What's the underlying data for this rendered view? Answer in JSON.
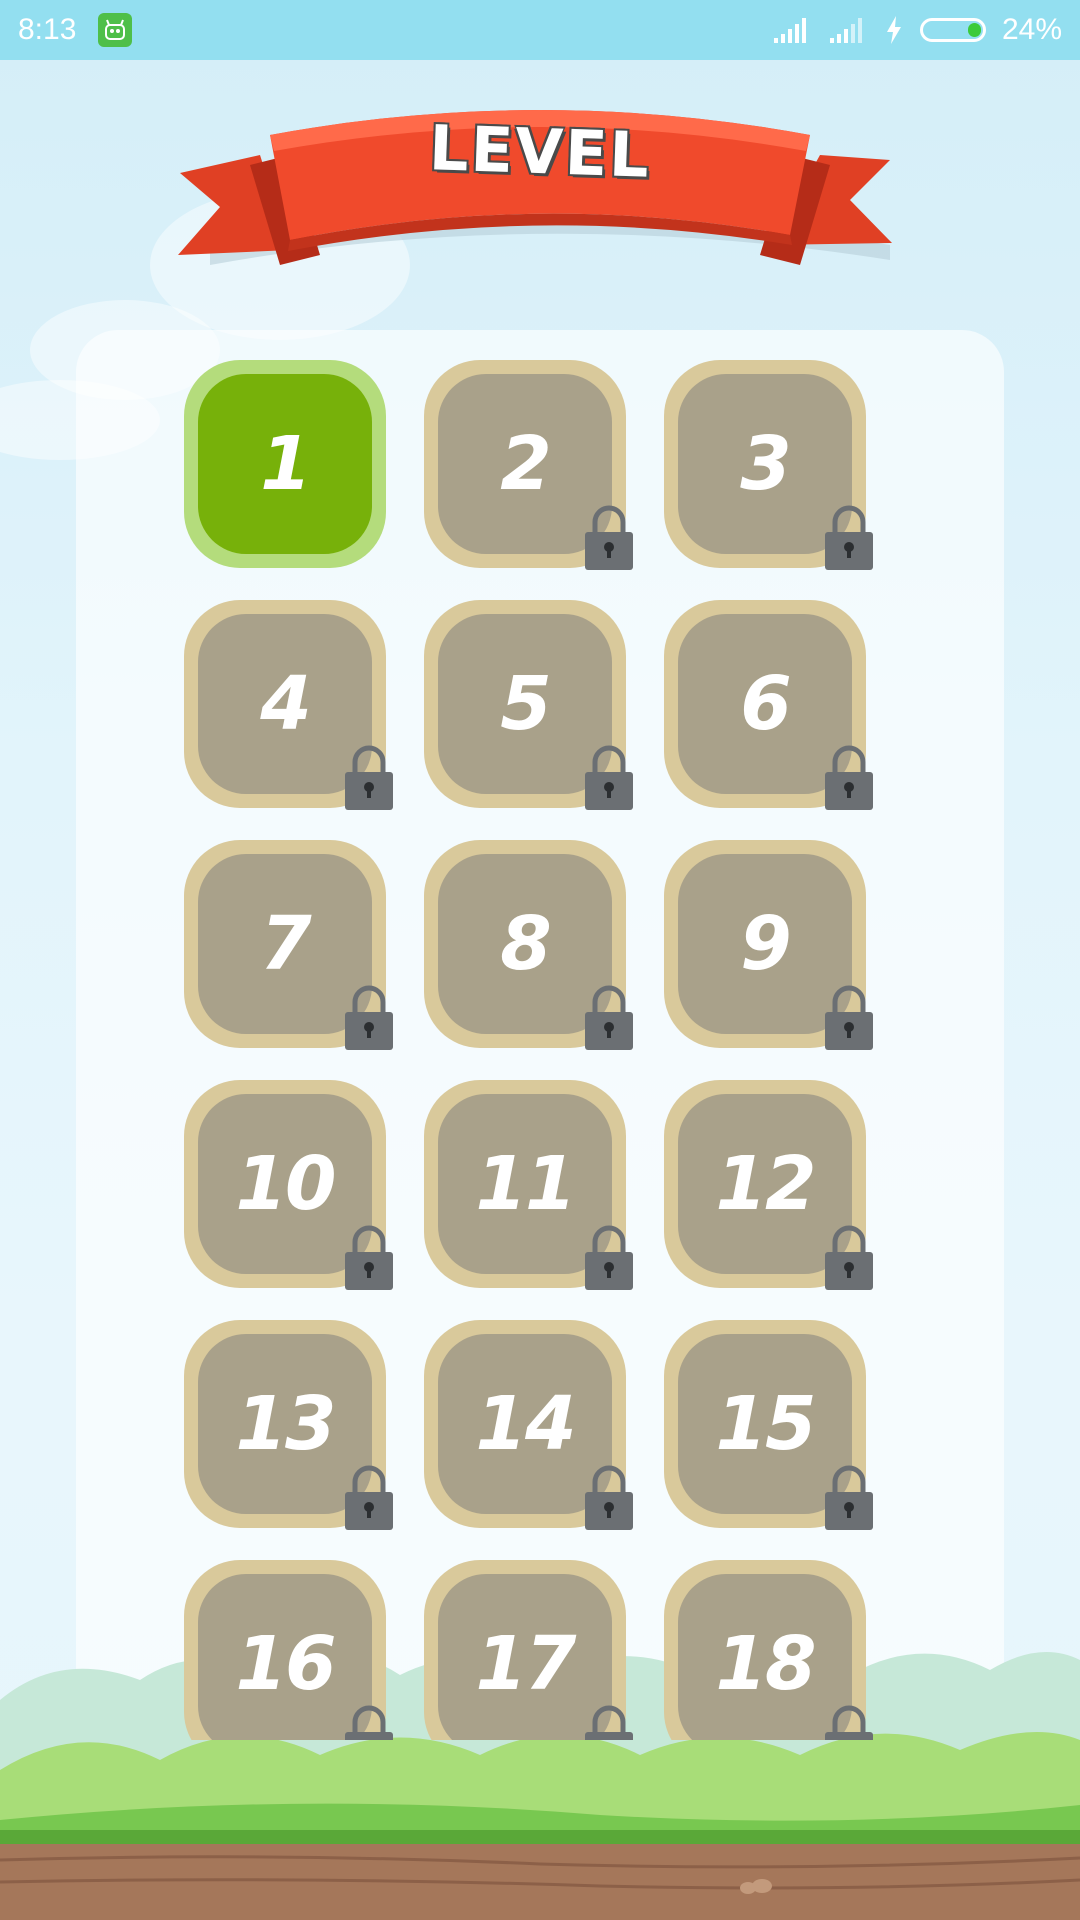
{
  "status_bar": {
    "time": "8:13",
    "battery_percent": "24%",
    "battery_level": 0.24,
    "icons": [
      "app-notification-icon",
      "cell-signal-icon",
      "cell-signal-icon",
      "charging-icon",
      "battery-icon"
    ]
  },
  "header": {
    "title": "LEVEL"
  },
  "levels": [
    {
      "number": "1",
      "locked": false
    },
    {
      "number": "2",
      "locked": true
    },
    {
      "number": "3",
      "locked": true
    },
    {
      "number": "4",
      "locked": true
    },
    {
      "number": "5",
      "locked": true
    },
    {
      "number": "6",
      "locked": true
    },
    {
      "number": "7",
      "locked": true
    },
    {
      "number": "8",
      "locked": true
    },
    {
      "number": "9",
      "locked": true
    },
    {
      "number": "10",
      "locked": true
    },
    {
      "number": "11",
      "locked": true
    },
    {
      "number": "12",
      "locked": true
    },
    {
      "number": "13",
      "locked": true
    },
    {
      "number": "14",
      "locked": true
    },
    {
      "number": "15",
      "locked": true
    },
    {
      "number": "16",
      "locked": true
    },
    {
      "number": "17",
      "locked": true
    },
    {
      "number": "18",
      "locked": true
    }
  ],
  "colors": {
    "status_bar": "#93dff0",
    "banner_red": "#f04a2c",
    "unlocked_tile": "#77b10a",
    "locked_tile": "#a9a18a",
    "tile_border": "#d9c99b",
    "lock": "#6b6f73"
  }
}
